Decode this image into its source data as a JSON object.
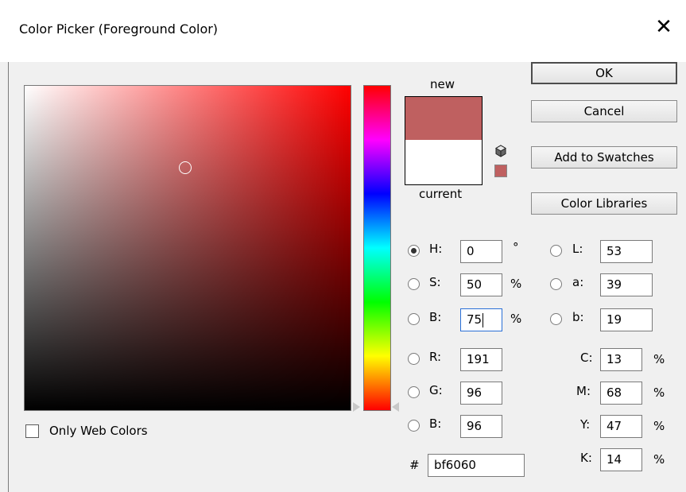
{
  "window": {
    "title": "Color Picker (Foreground Color)",
    "close_glyph": "✕"
  },
  "swatch": {
    "new_label": "new",
    "current_label": "current",
    "new_color": "#bf6060",
    "current_color": "#ffffff"
  },
  "buttons": {
    "ok": "OK",
    "cancel": "Cancel",
    "add_to_swatches": "Add to Swatches",
    "color_libraries": "Color Libraries"
  },
  "hsb": {
    "h": {
      "label": "H:",
      "value": "0",
      "unit": "°",
      "selected": true
    },
    "s": {
      "label": "S:",
      "value": "50",
      "unit": "%"
    },
    "b": {
      "label": "B:",
      "value": "75",
      "unit": "%"
    }
  },
  "rgb": {
    "r": {
      "label": "R:",
      "value": "191"
    },
    "g": {
      "label": "G:",
      "value": "96"
    },
    "b": {
      "label": "B:",
      "value": "96"
    }
  },
  "lab": {
    "l": {
      "label": "L:",
      "value": "53"
    },
    "a": {
      "label": "a:",
      "value": "39"
    },
    "b": {
      "label": "b:",
      "value": "19"
    }
  },
  "cmyk": {
    "c": {
      "label": "C:",
      "value": "13",
      "unit": "%"
    },
    "m": {
      "label": "M:",
      "value": "68",
      "unit": "%"
    },
    "y": {
      "label": "Y:",
      "value": "47",
      "unit": "%"
    },
    "k": {
      "label": "K:",
      "value": "14",
      "unit": "%"
    }
  },
  "hex": {
    "label": "#",
    "value": "bf6060"
  },
  "web_colors": {
    "label": "Only Web Colors",
    "checked": false
  },
  "icons": [
    "close-icon",
    "gamut-cube-icon",
    "web-safe-swatch-icon"
  ]
}
